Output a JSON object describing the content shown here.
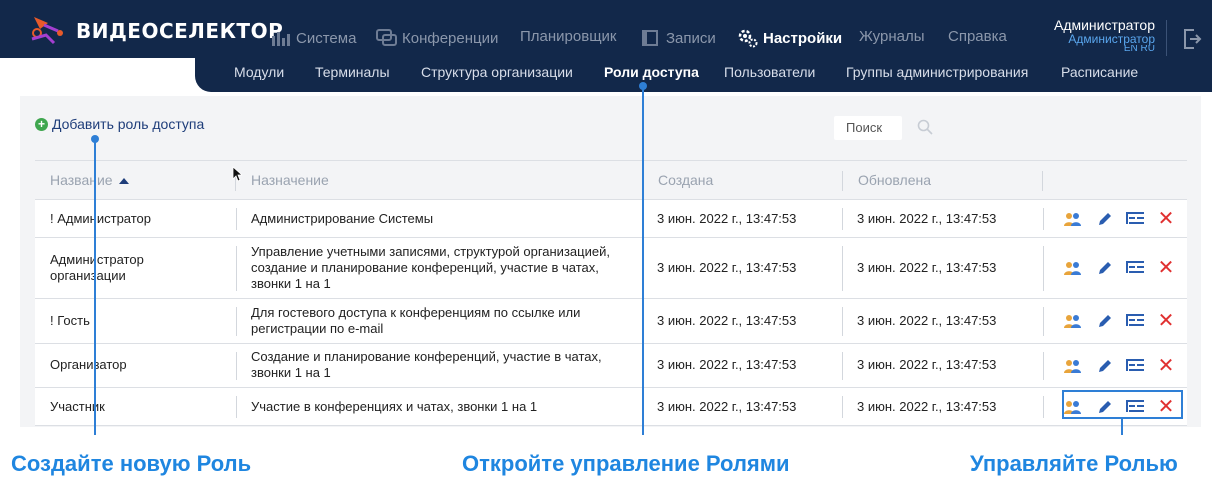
{
  "brand": {
    "name": "ВИДЕОСЕЛЕКТОР"
  },
  "topnav": {
    "items": [
      {
        "label": "Система",
        "icon": "bar-chart-icon"
      },
      {
        "label": "Конференции",
        "icon": "chat-bubbles-icon"
      },
      {
        "label": "Планировщик",
        "icon": ""
      },
      {
        "label": "Записи",
        "icon": "film-icon"
      },
      {
        "label": "Настройки",
        "icon": "gears-icon",
        "active": true
      },
      {
        "label": "Журналы",
        "icon": ""
      },
      {
        "label": "Справка",
        "icon": ""
      }
    ]
  },
  "user": {
    "name": "Администратор",
    "role": "Администратор",
    "lang": "EN RU"
  },
  "subnav": {
    "items": [
      {
        "label": "Модули"
      },
      {
        "label": "Терминалы"
      },
      {
        "label": "Структура организации"
      },
      {
        "label": "Роли доступа",
        "active": true
      },
      {
        "label": "Пользователи"
      },
      {
        "label": "Группы администрирования"
      },
      {
        "label": "Расписание"
      }
    ]
  },
  "toolbar": {
    "add_label": "Добавить роль доступа",
    "search_placeholder": "Поиск"
  },
  "table": {
    "columns": [
      "Название",
      "Назначение",
      "Создана",
      "Обновлена"
    ],
    "sort": {
      "column": "Название",
      "direction": "asc"
    },
    "rows": [
      {
        "name": "! Администратор",
        "purpose": "Администрирование Системы",
        "created": "3 июн. 2022 г., 13:47:53",
        "updated": "3 июн. 2022 г., 13:47:53"
      },
      {
        "name": "Администратор организации",
        "purpose": "Управление учетными записями, структурой организацией, создание и планирование конференций, участие в чатах, звонки 1 на 1",
        "created": "3 июн. 2022 г., 13:47:53",
        "updated": "3 июн. 2022 г., 13:47:53"
      },
      {
        "name": "! Гость",
        "purpose": "Для гостевого доступа к конференциям по ссылке или регистрации по e-mail",
        "created": "3 июн. 2022 г., 13:47:53",
        "updated": "3 июн. 2022 г., 13:47:53"
      },
      {
        "name": "Организатор",
        "purpose": "Создание и планирование конференций, участие в чатах, звонки 1 на 1",
        "created": "3 июн. 2022 г., 13:47:53",
        "updated": "3 июн. 2022 г., 13:47:53"
      },
      {
        "name": "Участник",
        "purpose": "Участие в конференциях и чатах, звонки 1 на 1",
        "created": "3 июн. 2022 г., 13:47:53",
        "updated": "3 июн. 2022 г., 13:47:53"
      }
    ],
    "row_actions": [
      "users-icon",
      "pencil-icon",
      "hierarchy-icon",
      "delete-icon"
    ]
  },
  "annotations": {
    "create": "Создайте новую Роль",
    "open": "Откройте управление Ролями",
    "manage": "Управляйте Ролью"
  },
  "colors": {
    "navbar": "#12284a",
    "accent": "#1f86e0",
    "delete": "#e03030",
    "add": "#3fa64f"
  }
}
